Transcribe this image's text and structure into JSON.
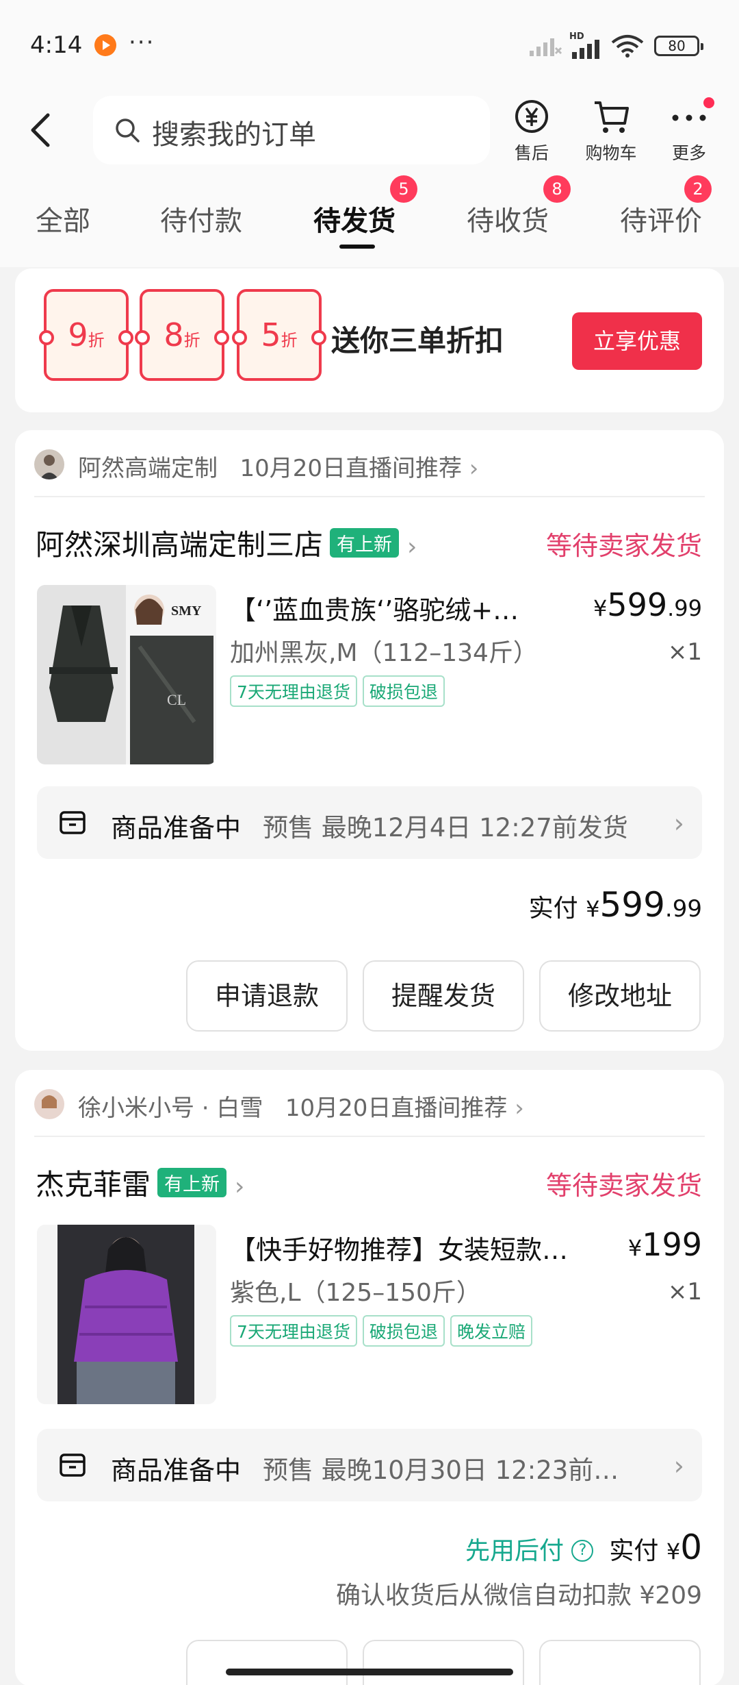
{
  "status_bar": {
    "time": "4:14",
    "more": "···",
    "hd": "HD",
    "battery": "80"
  },
  "header": {
    "search_placeholder": "搜索我的订单",
    "buttons": [
      {
        "label": "售后",
        "icon": "refund-yen-icon"
      },
      {
        "label": "购物车",
        "icon": "cart-icon"
      },
      {
        "label": "更多",
        "icon": "more-dots-icon"
      }
    ]
  },
  "tabs": [
    {
      "label": "全部"
    },
    {
      "label": "待付款"
    },
    {
      "label": "待发货",
      "badge": "5"
    },
    {
      "label": "待收货",
      "badge": "8"
    },
    {
      "label": "待评价",
      "badge": "2"
    }
  ],
  "promo": {
    "coupons": [
      {
        "num": "9",
        "unit": "折"
      },
      {
        "num": "8",
        "unit": "折"
      },
      {
        "num": "5",
        "unit": "折"
      }
    ],
    "text": "送你三单折扣",
    "button": "立享优惠"
  },
  "orders": [
    {
      "recommender": "阿然高端定制",
      "rec_note": "10月20日直播间推荐",
      "shop": "阿然深圳高端定制三店",
      "shop_tag": "有上新",
      "status": "等待卖家发货",
      "title": "【‘’蓝血贵族‘’骆驼绒+…",
      "spec": "加州黑灰,M（112–134斤）",
      "tags": [
        "7天无理由退货",
        "破损包退"
      ],
      "price_yen": "¥",
      "price_int": "599",
      "price_dec": ".99",
      "qty": "×1",
      "image_brand": "SMY",
      "shipping_state": "商品准备中",
      "shipping_note": "预售  最晚12月4日 12:27前发货",
      "total_label": "实付",
      "total_yen": "¥",
      "total_int": "599",
      "total_dec": ".99",
      "actions": [
        "申请退款",
        "提醒发货",
        "修改地址"
      ]
    },
    {
      "recommender": "徐小米小号 · 白雪",
      "rec_note": "10月20日直播间推荐",
      "shop": "杰克菲雷",
      "shop_tag": "有上新",
      "status": "等待卖家发货",
      "title": "【快手好物推荐】女装短款…",
      "spec": "紫色,L（125–150斤）",
      "tags": [
        "7天无理由退货",
        "破损包退",
        "晚发立赔"
      ],
      "price_yen": "¥",
      "price_int": "199",
      "qty": "×1",
      "shipping_state": "商品准备中",
      "shipping_note": "预售  最晚10月30日 12:23前…",
      "pay_later": "先用后付",
      "total_label": "实付",
      "total_yen": "¥",
      "total_int": "0",
      "auto_deduct": "确认收货后从微信自动扣款 ¥209"
    }
  ],
  "colors": {
    "accent_red": "#f0304a",
    "status_pink": "#e2406c",
    "tag_green": "#1fb17a",
    "pay_later_teal": "#16a88e"
  }
}
